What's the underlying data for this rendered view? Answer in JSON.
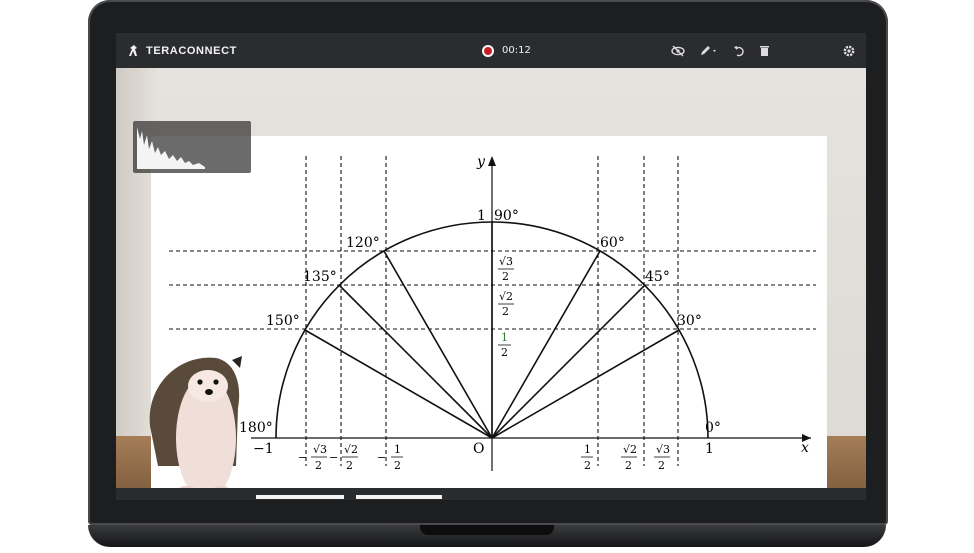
{
  "app": {
    "brand": "TERACONNECT",
    "timer": "00:12"
  },
  "toolbar": {
    "tools": [
      "eye-off-icon",
      "pen-icon",
      "undo-icon",
      "trash-icon"
    ],
    "settings_icon": "gear-icon"
  },
  "diagram": {
    "x_axis_label": "x",
    "y_axis_label": "y",
    "origin_label": "O",
    "left_one": "−1",
    "right_one": "1",
    "top_one": "1",
    "angles": [
      "0°",
      "30°",
      "45°",
      "60°",
      "90°",
      "120°",
      "135°",
      "150°",
      "180°"
    ],
    "fractions": {
      "sqrt3": "√3",
      "sqrt2": "√2",
      "one": "1",
      "two": "2"
    }
  },
  "colors": {
    "accent_record": "#c61e2b",
    "bar": "#2b2c2f",
    "fraction_green": "#2e7d32"
  }
}
